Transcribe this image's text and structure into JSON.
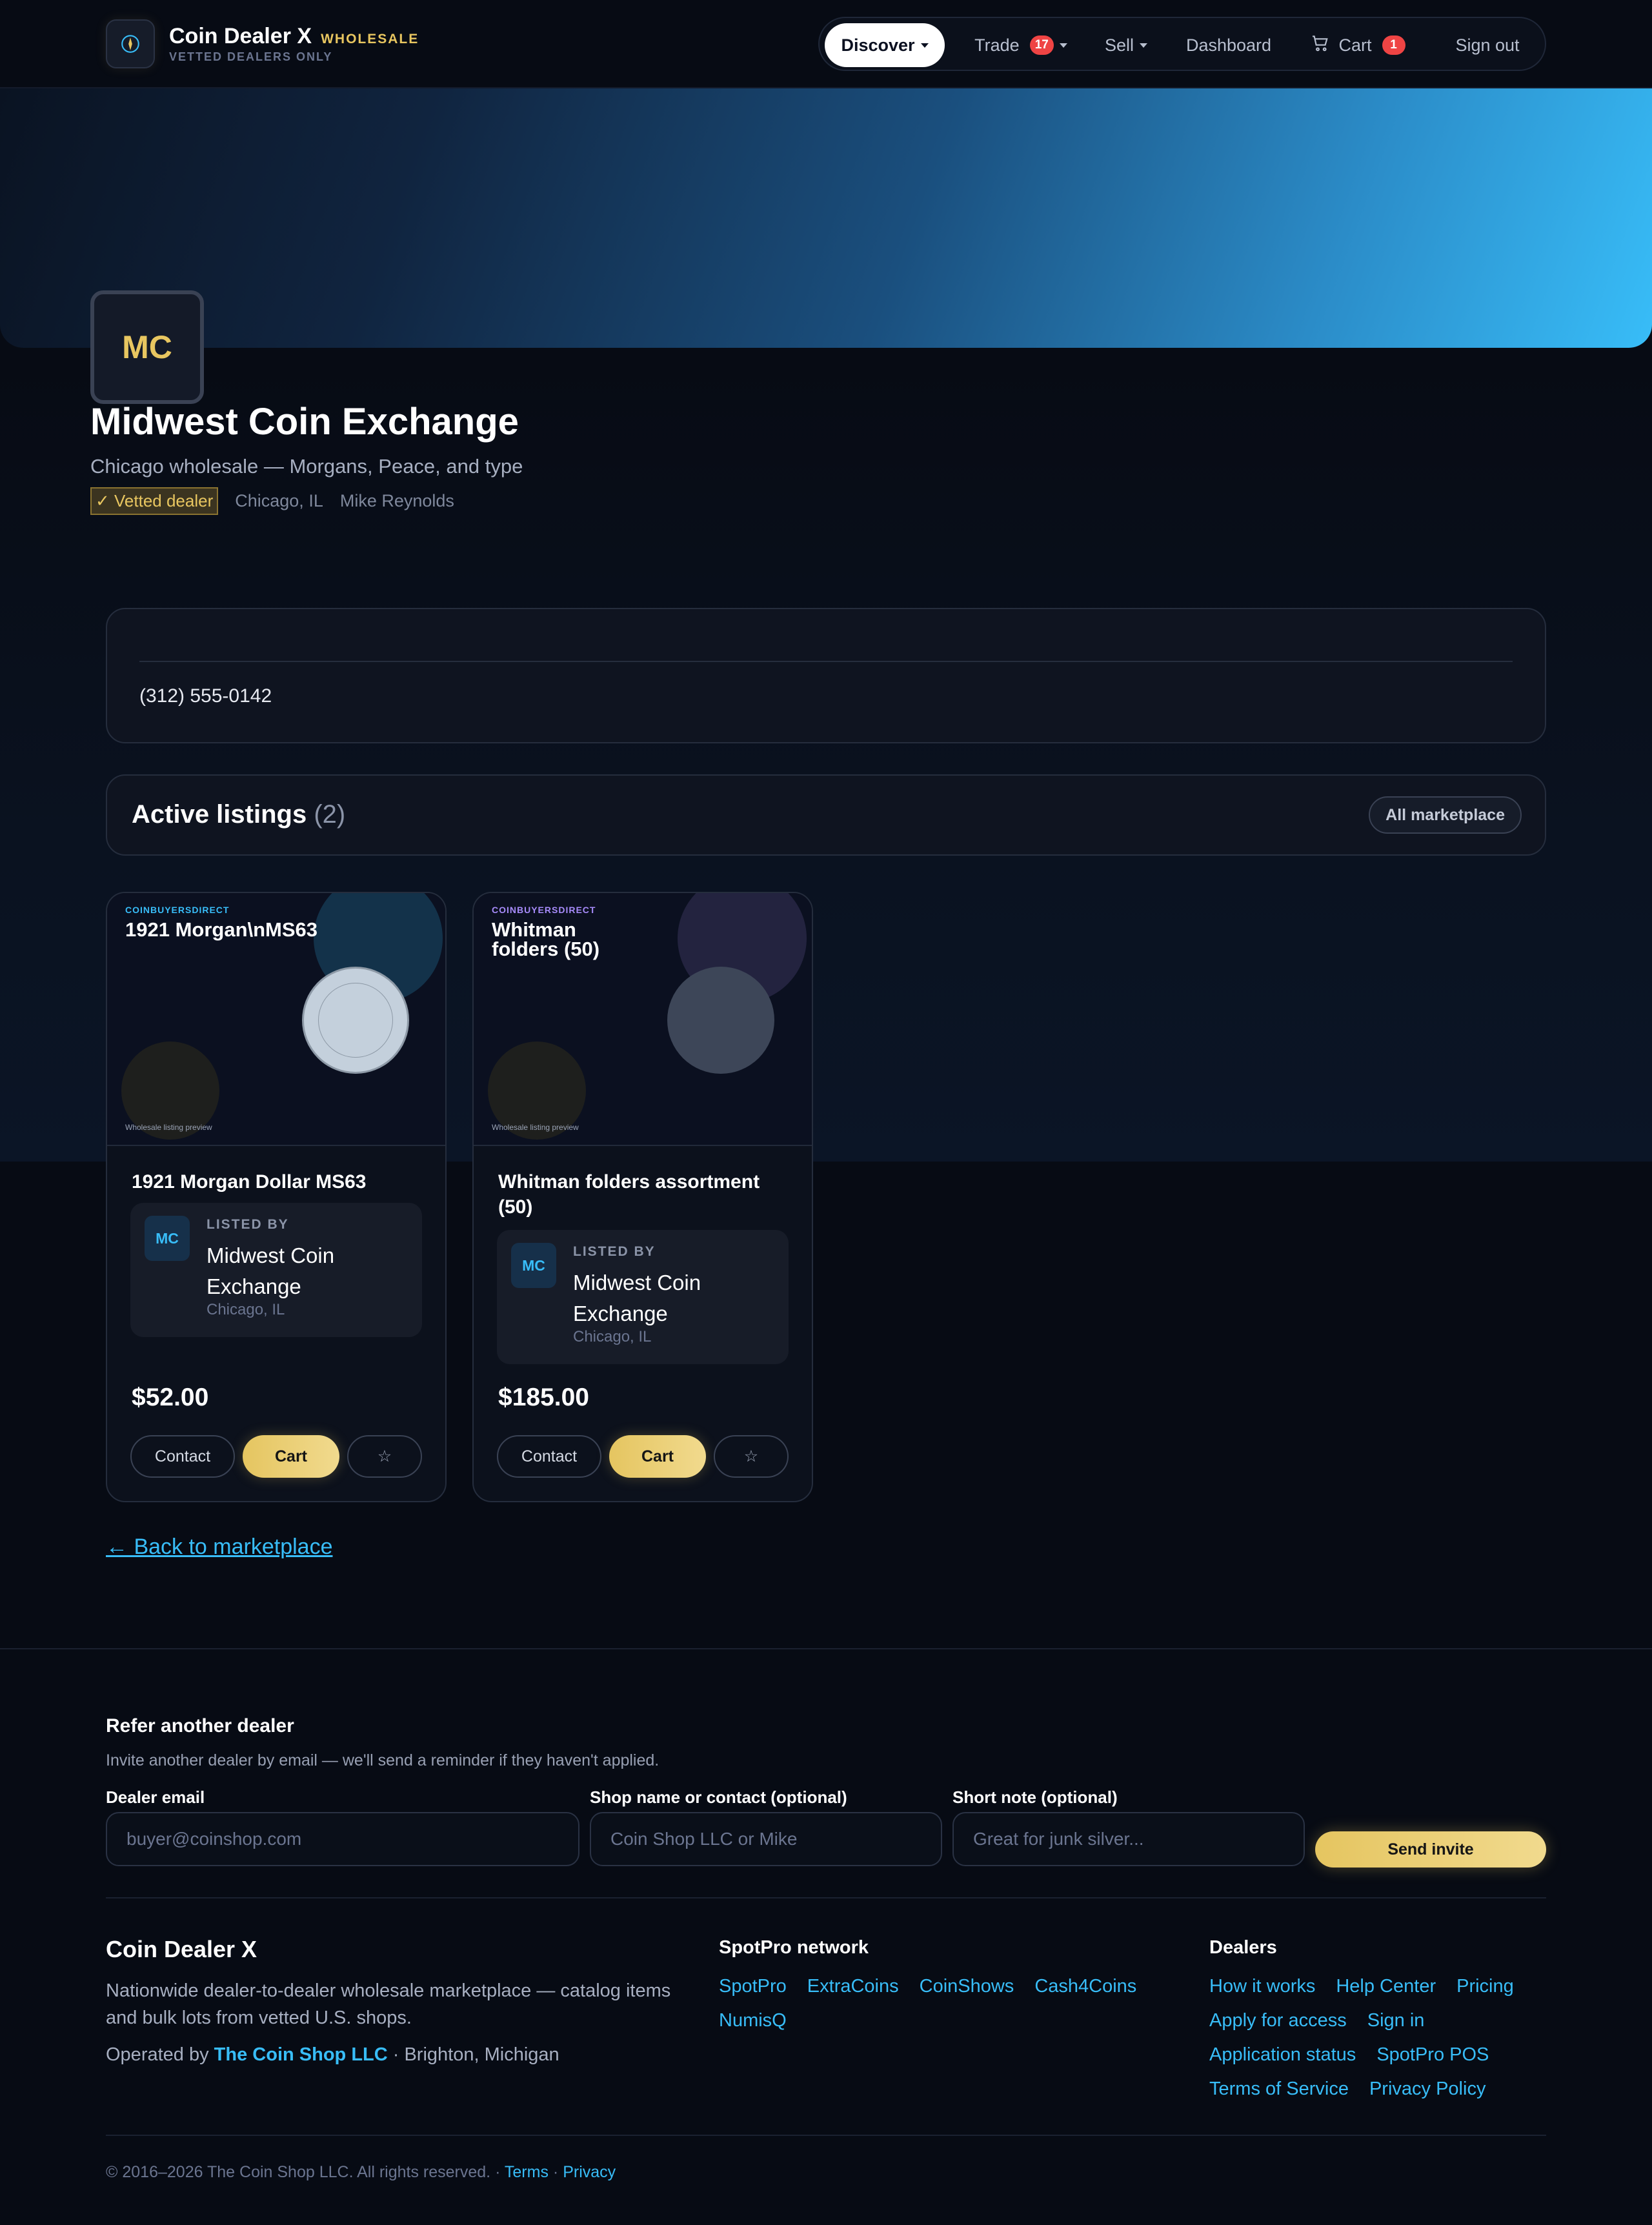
{
  "header": {
    "brand_name": "Coin Dealer X",
    "brand_tag": "WHOLESALE",
    "brand_sub": "VETTED DEALERS ONLY",
    "nav": {
      "discover": "Discover",
      "trade": "Trade",
      "trade_badge": "17",
      "sell": "Sell",
      "dashboard": "Dashboard",
      "cart": "Cart",
      "cart_badge": "1",
      "signout": "Sign out"
    }
  },
  "profile": {
    "initials": "MC",
    "name": "Midwest Coin Exchange",
    "tagline": "Chicago wholesale — Morgans, Peace, and type",
    "vetted": "✓ Vetted dealer",
    "location": "Chicago, IL",
    "contact_person": "Mike Reynolds",
    "phone": "(312) 555-0142"
  },
  "listings": {
    "title": "Active listings",
    "count": "(2)",
    "all_marketplace": "All marketplace",
    "items": [
      {
        "source": "COINBUYERSDIRECT",
        "image_title": "1921 Morgan\\nMS63",
        "preview_caption": "Wholesale listing preview",
        "name": "1921 Morgan Dollar MS63",
        "listed_by_label": "LISTED BY",
        "seller_initials": "MC",
        "seller_name": "Midwest Coin Exchange",
        "seller_location": "Chicago, IL",
        "price": "$52.00",
        "contact_label": "Contact",
        "cart_label": "Cart",
        "star_label": "☆"
      },
      {
        "source": "COINBUYERSDIRECT",
        "image_title": "Whitman folders (50)",
        "preview_caption": "Wholesale listing preview",
        "name": "Whitman folders assortment (50)",
        "listed_by_label": "LISTED BY",
        "seller_initials": "MC",
        "seller_name": "Midwest Coin Exchange",
        "seller_location": "Chicago, IL",
        "price": "$185.00",
        "contact_label": "Contact",
        "cart_label": "Cart",
        "star_label": "☆"
      }
    ]
  },
  "back_link": "← Back to marketplace",
  "refer": {
    "title": "Refer another dealer",
    "subtitle": "Invite another dealer by email — we'll send a reminder if they haven't applied.",
    "email_label": "Dealer email",
    "email_placeholder": "buyer@coinshop.com",
    "shop_label": "Shop name or contact (optional)",
    "shop_placeholder": "Coin Shop LLC or Mike",
    "note_label": "Short note (optional)",
    "note_placeholder": "Great for junk silver...",
    "send_label": "Send invite"
  },
  "footer": {
    "brand": "Coin Dealer X",
    "description": "Nationwide dealer-to-dealer wholesale marketplace — catalog items and bulk lots from vetted U.S. shops.",
    "operated_prefix": "Operated by",
    "operated_link": "The Coin Shop LLC",
    "operated_suffix": "· Brighton, Michigan",
    "network_title": "SpotPro network",
    "network_links": [
      "SpotPro",
      "ExtraCoins",
      "CoinShows",
      "Cash4Coins",
      "NumisQ"
    ],
    "dealers_title": "Dealers",
    "dealer_links": [
      "How it works",
      "Help Center",
      "Pricing",
      "Apply for access",
      "Sign in",
      "Application status",
      "SpotPro POS",
      "Terms of Service",
      "Privacy Policy"
    ],
    "copyright": "© 2016–2026 The Coin Shop LLC. All rights reserved.",
    "sep": "·",
    "terms": "Terms",
    "privacy": "Privacy"
  },
  "colors": {
    "accent_gold": "#e8c660",
    "accent_blue": "#38bdf8",
    "badge_red": "#ef4444",
    "background": "#070b14"
  },
  "icons": [
    "shield-coin-icon",
    "caret-down-icon",
    "cart-icon",
    "star-icon"
  ]
}
